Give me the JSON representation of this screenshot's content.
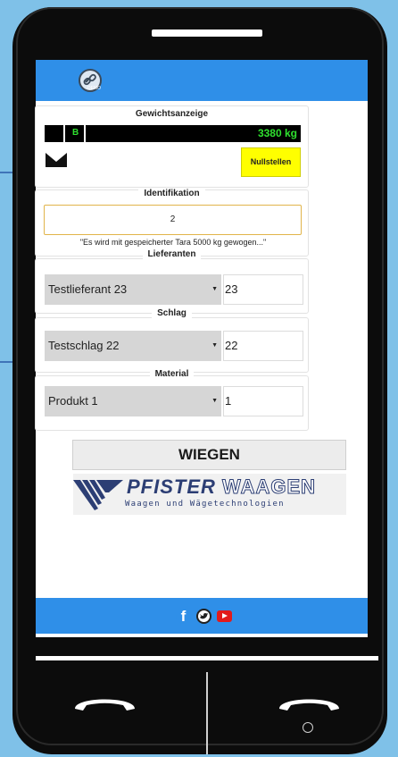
{
  "app": {
    "logo_icon": "chain-link-icon",
    "logo_sub": "DEMO"
  },
  "weight_display": {
    "title": "Gewichtsanzeige",
    "mode": "B",
    "value": "3380 kg",
    "zero_button": "Nullstellen",
    "zero_icon": "scale-zero-icon"
  },
  "identification": {
    "title": "Identifikation",
    "value": "2",
    "note": "\"Es wird mit gespeicherter Tara 5000 kg gewogen...\""
  },
  "lieferanten": {
    "title": "Lieferanten",
    "selected": "Testlieferant 23",
    "number": "23"
  },
  "schlag": {
    "title": "Schlag",
    "selected": "Testschlag 22",
    "number": "22"
  },
  "material": {
    "title": "Material",
    "selected": "Produkt 1",
    "number": "1"
  },
  "actions": {
    "weigh_label": "WIEGEN"
  },
  "brand": {
    "name_part1": "PFISTER",
    "name_part2": "WAAGEN",
    "tagline": "Waagen und Wägetechnologien"
  },
  "footer": {
    "icons": [
      "facebook-icon",
      "twitter-icon",
      "youtube-icon"
    ]
  },
  "colors": {
    "accent": "#2f8fe8",
    "weight_text": "#2fe02f",
    "zero_button": "#ffff00",
    "background": "#7fc1e8"
  }
}
